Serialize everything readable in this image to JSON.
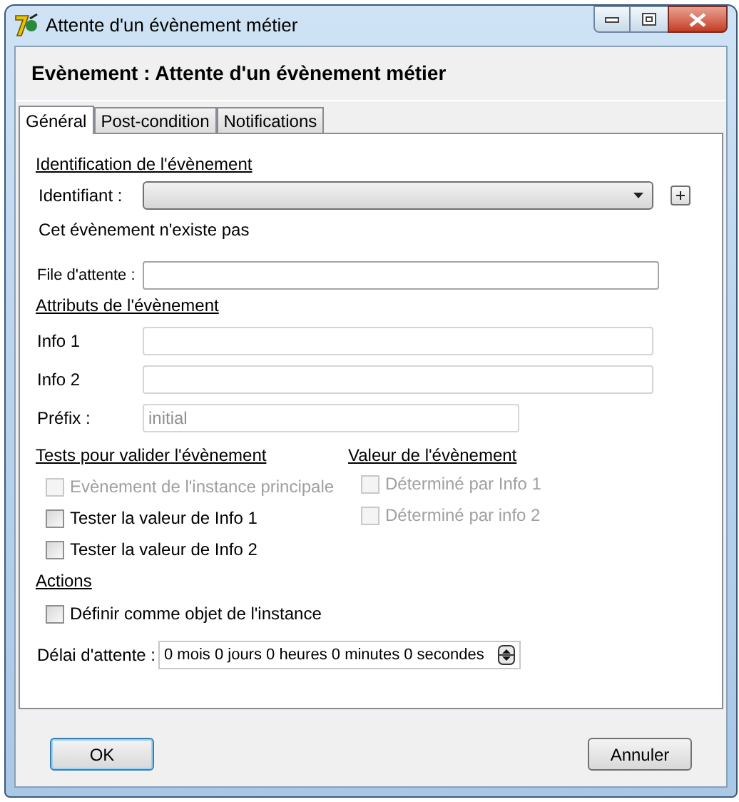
{
  "window": {
    "title": "Attente d'un évènement métier"
  },
  "header": {
    "title": "Evènement : Attente d'un évènement métier"
  },
  "tabs": [
    {
      "label": "Général",
      "selected": true
    },
    {
      "label": "Post-condition",
      "selected": false
    },
    {
      "label": "Notifications",
      "selected": false
    }
  ],
  "identification": {
    "heading": "Identification de l'évènement",
    "label": "Identifiant :",
    "message": "Cet évènement n'existe pas"
  },
  "queue": {
    "label": "File d'attente :",
    "disabled": false
  },
  "attributes": {
    "heading": "Attributs de l'évènement",
    "fields": [
      {
        "label": "Info 1",
        "disabled": true
      },
      {
        "label": "Info 2",
        "disabled": true
      },
      {
        "label": "Préfix :",
        "value": "initial",
        "disabled": true
      }
    ]
  },
  "tests": {
    "heading": "Tests pour valider l'évènement",
    "items": [
      {
        "label": "Evènement de l'instance principale",
        "checked": false,
        "disabled": true
      },
      {
        "label": "Tester la valeur de Info 1",
        "checked": false,
        "disabled": false
      },
      {
        "label": "Tester la valeur de Info 2",
        "checked": false,
        "disabled": false
      }
    ]
  },
  "value": {
    "heading": "Valeur de l'évènement",
    "items": [
      {
        "label": "Déterminé par Info 1",
        "checked": false,
        "disabled": true
      },
      {
        "label": "Déterminé par info 2",
        "checked": false,
        "disabled": true
      }
    ]
  },
  "actions": {
    "heading": "Actions",
    "items": [
      {
        "label": "Définir comme objet de l'instance",
        "checked": false,
        "disabled": false
      }
    ]
  },
  "delay": {
    "label": "Délai d'attente :",
    "value": "0 mois 0 jours 0 heures 0 minutes 0 secondes"
  },
  "buttons": [
    {
      "label": "OK",
      "focused": true
    },
    {
      "label": "Annuler",
      "focused": false
    }
  ]
}
